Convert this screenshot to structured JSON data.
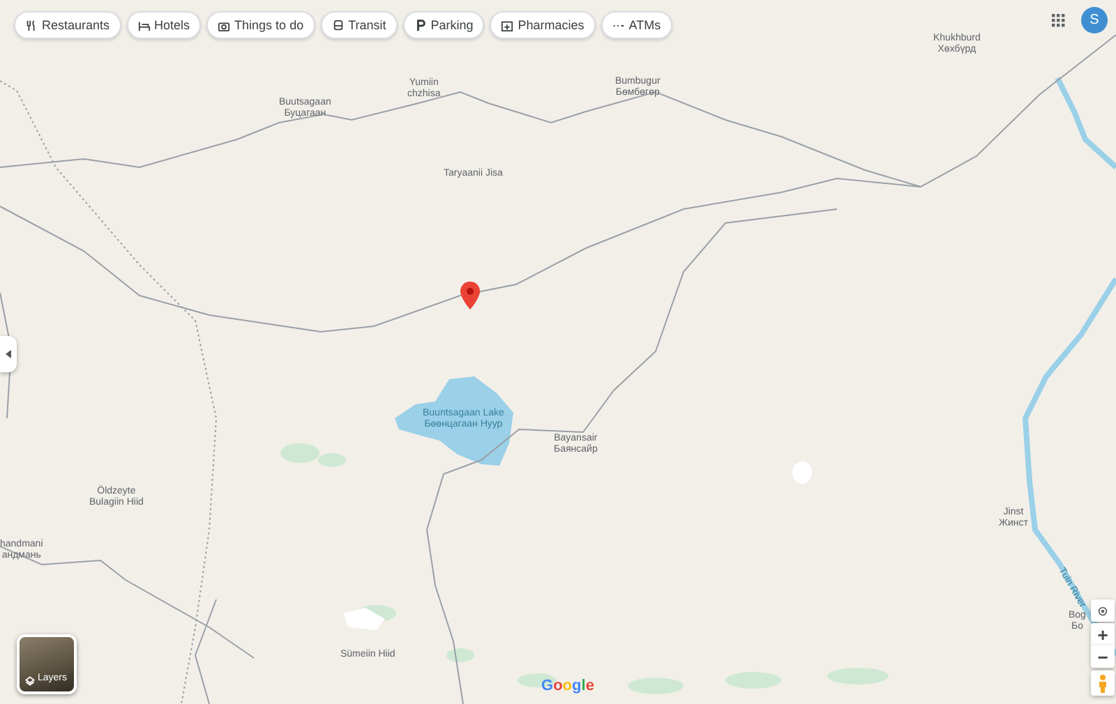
{
  "category_chips": [
    {
      "label": "Restaurants",
      "kind": "restaurants"
    },
    {
      "label": "Hotels",
      "kind": "hotels"
    },
    {
      "label": "Things to do",
      "kind": "camera"
    },
    {
      "label": "Transit",
      "kind": "transit"
    },
    {
      "label": "Parking",
      "kind": "parking"
    },
    {
      "label": "Pharmacies",
      "kind": "pharmacy"
    },
    {
      "label": "ATMs",
      "kind": "atm"
    }
  ],
  "account": {
    "initial": "S"
  },
  "map": {
    "places": [
      {
        "kind": "town",
        "lines": [
          "Buutsagaan",
          "Буцагаан"
        ]
      },
      {
        "kind": "town",
        "lines": [
          "Yumiin",
          "chzhisa"
        ]
      },
      {
        "kind": "town",
        "lines": [
          "Bumbugur",
          "Бөмбөгөр"
        ]
      },
      {
        "kind": "town",
        "lines": [
          "Khukhburd",
          "Хөхбүрд"
        ]
      },
      {
        "kind": "area",
        "lines": [
          "Taryaanii Jisa"
        ]
      },
      {
        "kind": "water",
        "lines": [
          "Buuntsagaan Lake",
          "Бөөнцагаан Нуур"
        ]
      },
      {
        "kind": "town",
        "lines": [
          "Bayansair",
          "Баянсайр"
        ]
      },
      {
        "kind": "area",
        "lines": [
          "Öldzeyte",
          "Bulagiin Hiid"
        ]
      },
      {
        "kind": "town",
        "lines": [
          "handmani",
          "андмань"
        ]
      },
      {
        "kind": "area",
        "lines": [
          "Sümeiin Hiid"
        ]
      },
      {
        "kind": "town",
        "lines": [
          "Jinst",
          "Жинст"
        ]
      },
      {
        "kind": "river",
        "lines": [
          "Tuin River"
        ]
      },
      {
        "kind": "town",
        "lines": [
          "Bog",
          "Бо"
        ]
      }
    ],
    "layers_button": {
      "label": "Layers"
    },
    "logo": "Google",
    "zoom": {
      "in": "+",
      "out": "−"
    }
  }
}
